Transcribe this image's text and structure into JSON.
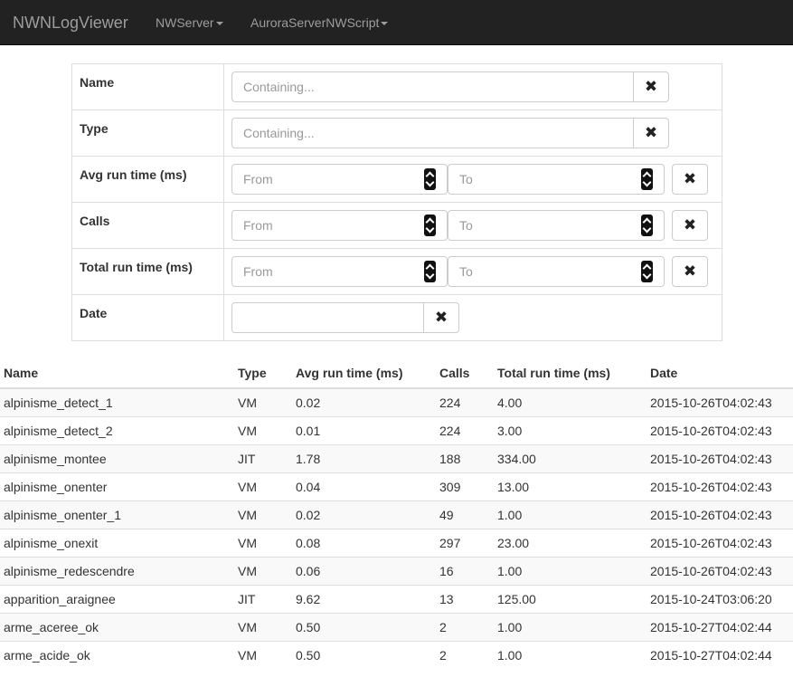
{
  "navbar": {
    "brand": "NWNLogViewer",
    "menus": [
      {
        "label": "NWServer"
      },
      {
        "label": "AuroraServerNWScript"
      }
    ]
  },
  "filters": {
    "name": {
      "label": "Name",
      "placeholder": "Containing...",
      "clear_icon": "times-icon"
    },
    "type": {
      "label": "Type",
      "placeholder": "Containing...",
      "clear_icon": "times-icon"
    },
    "avg": {
      "label": "Avg run time (ms)",
      "from_placeholder": "From",
      "to_placeholder": "To"
    },
    "calls": {
      "label": "Calls",
      "from_placeholder": "From",
      "to_placeholder": "To"
    },
    "total": {
      "label": "Total run time (ms)",
      "from_placeholder": "From",
      "to_placeholder": "To"
    },
    "date": {
      "label": "Date",
      "value": ""
    }
  },
  "table": {
    "headers": [
      "Name",
      "Type",
      "Avg run time (ms)",
      "Calls",
      "Total run time (ms)",
      "Date"
    ],
    "rows": [
      [
        "alpinisme_detect_1",
        "VM",
        "0.02",
        "224",
        "4.00",
        "2015-10-26T04:02:43"
      ],
      [
        "alpinisme_detect_2",
        "VM",
        "0.01",
        "224",
        "3.00",
        "2015-10-26T04:02:43"
      ],
      [
        "alpinisme_montee",
        "JIT",
        "1.78",
        "188",
        "334.00",
        "2015-10-26T04:02:43"
      ],
      [
        "alpinisme_onenter",
        "VM",
        "0.04",
        "309",
        "13.00",
        "2015-10-26T04:02:43"
      ],
      [
        "alpinisme_onenter_1",
        "VM",
        "0.02",
        "49",
        "1.00",
        "2015-10-26T04:02:43"
      ],
      [
        "alpinisme_onexit",
        "VM",
        "0.08",
        "297",
        "23.00",
        "2015-10-26T04:02:43"
      ],
      [
        "alpinisme_redescendre",
        "VM",
        "0.06",
        "16",
        "1.00",
        "2015-10-26T04:02:43"
      ],
      [
        "apparition_araignee",
        "JIT",
        "9.62",
        "13",
        "125.00",
        "2015-10-24T03:06:20"
      ],
      [
        "arme_aceree_ok",
        "VM",
        "0.50",
        "2",
        "1.00",
        "2015-10-27T04:02:44"
      ],
      [
        "arme_acide_ok",
        "VM",
        "0.50",
        "2",
        "1.00",
        "2015-10-27T04:02:44"
      ]
    ]
  }
}
